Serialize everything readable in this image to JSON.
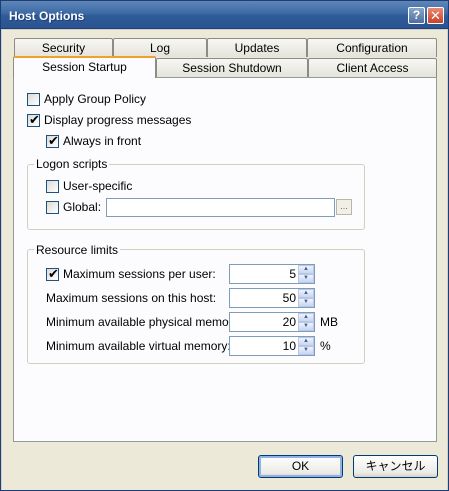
{
  "window": {
    "title": "Host Options",
    "help_label": "?",
    "close_label": "✕"
  },
  "tabs": {
    "row1": [
      {
        "label": "Security"
      },
      {
        "label": "Log"
      },
      {
        "label": "Updates"
      },
      {
        "label": "Configuration"
      }
    ],
    "row2": [
      {
        "label": "Session Startup",
        "active": true
      },
      {
        "label": "Session Shutdown"
      },
      {
        "label": "Client Access"
      }
    ]
  },
  "options": {
    "apply_group_policy": {
      "label": "Apply Group Policy",
      "checked": false
    },
    "display_progress": {
      "label": "Display progress messages",
      "checked": true
    },
    "always_in_front": {
      "label": "Always in front",
      "checked": true
    }
  },
  "logon_scripts": {
    "title": "Logon scripts",
    "user_specific": {
      "label": "User-specific",
      "checked": false
    },
    "global": {
      "label": "Global:",
      "checked": false,
      "value": ""
    },
    "browse_label": "..."
  },
  "resource_limits": {
    "title": "Resource limits",
    "max_sessions_per_user": {
      "label": "Maximum sessions per user:",
      "checked": true,
      "value": "5",
      "unit": ""
    },
    "max_sessions_host": {
      "label": "Maximum sessions on this host:",
      "value": "50",
      "unit": ""
    },
    "min_physical_memory": {
      "label": "Minimum available physical memory:",
      "value": "20",
      "unit": "MB"
    },
    "min_virtual_memory": {
      "label": "Minimum available virtual memory:",
      "value": "10",
      "unit": "%"
    }
  },
  "spin_up": "▲",
  "spin_down": "▼",
  "check_mark": "✔",
  "buttons": {
    "ok": "OK",
    "cancel": "キャンセル"
  },
  "colors": {
    "titlebar": "#3d6aa6",
    "dialog_bg": "#ece9d8",
    "active_tab_accent": "#f0a02c"
  }
}
